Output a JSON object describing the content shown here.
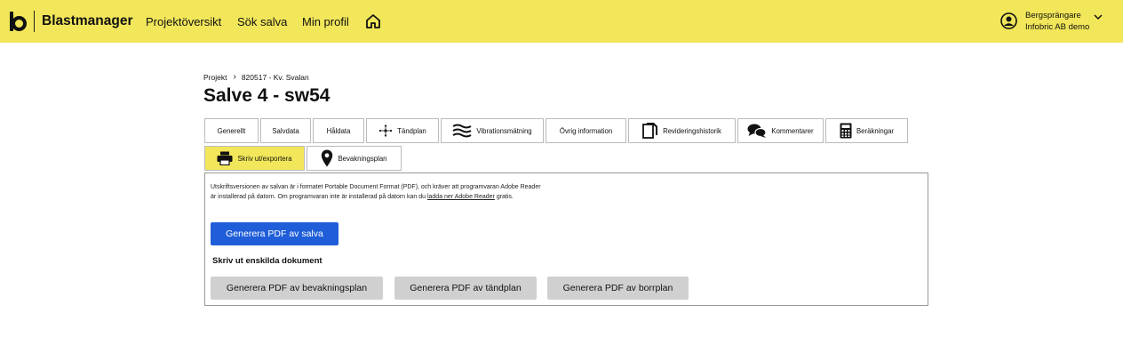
{
  "header": {
    "brand": "Blastmanager",
    "nav": [
      "Projektöversikt",
      "Sök salva",
      "Min profil"
    ],
    "user": {
      "role": "Bergsprängare",
      "org": "Infobric AB demo"
    },
    "bg_color": "#f2e75a"
  },
  "breadcrumb": {
    "root": "Projekt",
    "project": "820517 - Kv. Svalan"
  },
  "page_title": "Salve 4 - sw54",
  "tabs": [
    {
      "label": "Generellt",
      "icon": null
    },
    {
      "label": "Salvdata",
      "icon": null
    },
    {
      "label": "Håldata",
      "icon": null
    },
    {
      "label": "Tändplan",
      "icon": "detonation-icon"
    },
    {
      "label": "Vibrationsmätning",
      "icon": "waves-icon"
    },
    {
      "label": "Övrig information",
      "icon": null
    },
    {
      "label": "Revideringshistorik",
      "icon": "documents-icon"
    },
    {
      "label": "Kommentarer",
      "icon": "chat-icon"
    },
    {
      "label": "Beräkningar",
      "icon": "calculator-icon"
    },
    {
      "label": "Skriv ut/exportera",
      "icon": "printer-icon",
      "active": true
    },
    {
      "label": "Bevakningsplan",
      "icon": "map-pin-icon"
    }
  ],
  "panel": {
    "info_line1": "Utskriftsversionen av salvan är i formatet Portable Document Format (PDF), och kräver att programvaran Adobe Reader",
    "info_line2_pre": "är installerad på datorn. Om programvaran inte är installerad på datorn kan du ",
    "info_link": "ladda ner Adobe Reader",
    "info_line2_post": " gratis.",
    "primary_button": "Generera PDF av salva",
    "section_label": "Skriv ut enskilda dokument",
    "doc_buttons": [
      "Generera PDF av bevakningsplan",
      "Generera PDF av tändplan",
      "Generera PDF av borrplan"
    ],
    "primary_color": "#1f5ed8"
  }
}
